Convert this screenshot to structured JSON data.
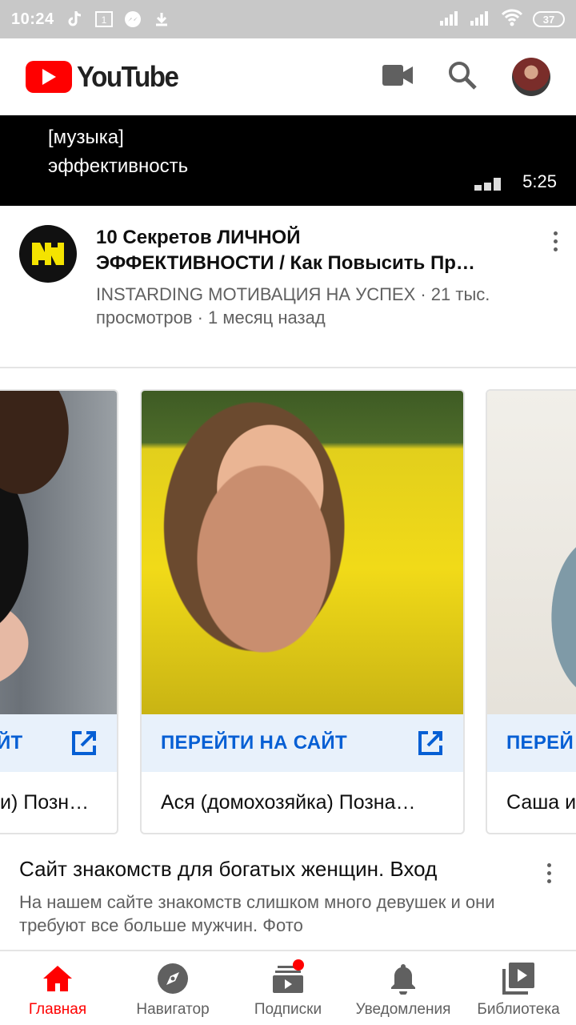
{
  "status_bar": {
    "time": "10:24",
    "left_icons": [
      "tiktok-icon",
      "sim-icon",
      "messenger-icon",
      "download-icon"
    ],
    "right_icons": [
      "signal-icon",
      "signal-icon",
      "wifi-icon"
    ],
    "battery": "37"
  },
  "appbar": {
    "logo_text": "YouTube",
    "icons": [
      "camera-icon",
      "search-icon",
      "avatar"
    ]
  },
  "player": {
    "caption_line1": "[музыка]",
    "caption_line2": "эффективность",
    "duration": "5:25"
  },
  "video": {
    "title_line1": "10 Секретов ЛИЧНОЙ",
    "title_line2": "ЭФФЕКТИВНОСТИ / Как Повысить Пр…",
    "meta_line1": "INSTARDING МОТИВАЦИЯ НА УСПЕХ · 21 тыс.",
    "meta_line2": "просмотров · 1 месяц назад"
  },
  "ad_cards": [
    {
      "cta": "ПЕРЕЙТИ НА САЙТ",
      "visible_cta": "ЙТ",
      "name": "и) Позн…"
    },
    {
      "cta": "ПЕРЕЙТИ НА САЙТ",
      "name": "Ася (домохозяйка) Позна…"
    },
    {
      "cta": "ПЕРЕЙ",
      "name": "Саша и"
    }
  ],
  "ad": {
    "title": "Сайт знакомств для богатых женщин. Вход",
    "description": "На нашем сайте знакомств слишком много девушек и они требуют все больше мужчин. Фото"
  },
  "bottom_nav": [
    {
      "label": "Главная",
      "active": true
    },
    {
      "label": "Навигатор",
      "active": false
    },
    {
      "label": "Подписки",
      "active": false,
      "badge": true
    },
    {
      "label": "Уведомления",
      "active": false
    },
    {
      "label": "Библиотека",
      "active": false
    }
  ],
  "colors": {
    "brand": "#ff0000",
    "link": "#065fd4",
    "secondary_text": "#606060"
  }
}
